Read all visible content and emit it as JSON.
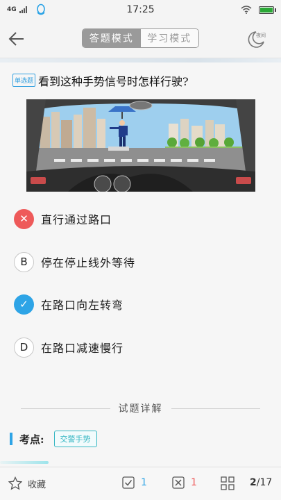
{
  "status_bar": {
    "network": "4G",
    "time": "17:25",
    "icons": [
      "signal-icon",
      "qq-icon",
      "wifi-icon",
      "battery-icon"
    ],
    "battery_level": 1.0
  },
  "header": {
    "mode_tabs": [
      {
        "label": "答题模式",
        "active": true
      },
      {
        "label": "学习模式",
        "active": false
      }
    ],
    "night_label": "夜间"
  },
  "question": {
    "type_badge": "单选题",
    "text": "看到这种手势信号时怎样行驶?"
  },
  "options": [
    {
      "marker": "✕",
      "state": "wrong",
      "text": "直行通过路口"
    },
    {
      "marker": "B",
      "state": "plain",
      "text": "停在停止线外等待"
    },
    {
      "marker": "✓",
      "state": "right",
      "text": "在路口向左转弯"
    },
    {
      "marker": "D",
      "state": "plain",
      "text": "在路口减速慢行"
    }
  ],
  "explanation": {
    "title": "试题详解",
    "key_point_label": "考点:",
    "key_point_tag": "交警手势"
  },
  "bottom_bar": {
    "favorite_label": "收藏",
    "correct_count": "1",
    "wrong_count": "1",
    "page_current": "2",
    "page_total": "/17"
  },
  "colors": {
    "accent_blue": "#2ea4e6",
    "wrong_red": "#ee5a5a",
    "tag_teal": "#34b6c2"
  }
}
